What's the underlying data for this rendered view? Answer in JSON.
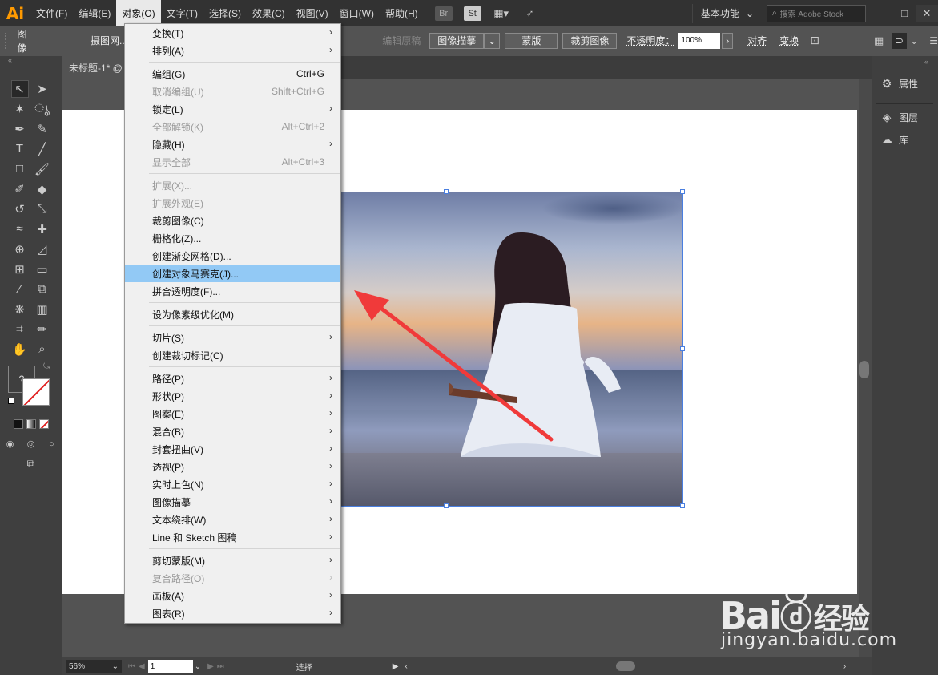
{
  "menubar": {
    "logo": "Ai",
    "items": [
      "文件(F)",
      "编辑(E)",
      "对象(O)",
      "文字(T)",
      "选择(S)",
      "效果(C)",
      "视图(V)",
      "窗口(W)",
      "帮助(H)"
    ],
    "bridge_icon": "Br",
    "stock_icon": "St",
    "workspace": "基本功能",
    "search_placeholder": "搜索 Adobe Stock"
  },
  "control_bar": {
    "label": "图像",
    "embed_button": "摄图网...",
    "edit_original": "编辑原稿",
    "image_trace": "图像描摹",
    "mask": "蒙版",
    "crop": "裁剪图像",
    "opacity_label": "不透明度：",
    "opacity_value": "100%",
    "align": "对齐",
    "transform": "变换"
  },
  "document": {
    "tab_title": "未标题-1* @"
  },
  "right_panel": {
    "items": [
      "属性",
      "图层",
      "库"
    ]
  },
  "object_menu": {
    "items": [
      {
        "label": "变换(T)",
        "shortcut": "",
        "submenu": true,
        "disabled": false
      },
      {
        "label": "排列(A)",
        "shortcut": "",
        "submenu": true,
        "disabled": false
      },
      {
        "sep": true
      },
      {
        "label": "编组(G)",
        "shortcut": "Ctrl+G",
        "submenu": false,
        "disabled": false
      },
      {
        "label": "取消编组(U)",
        "shortcut": "Shift+Ctrl+G",
        "submenu": false,
        "disabled": true
      },
      {
        "label": "锁定(L)",
        "shortcut": "",
        "submenu": true,
        "disabled": false
      },
      {
        "label": "全部解锁(K)",
        "shortcut": "Alt+Ctrl+2",
        "submenu": false,
        "disabled": true
      },
      {
        "label": "隐藏(H)",
        "shortcut": "",
        "submenu": true,
        "disabled": false
      },
      {
        "label": "显示全部",
        "shortcut": "Alt+Ctrl+3",
        "submenu": false,
        "disabled": true
      },
      {
        "sep": true
      },
      {
        "label": "扩展(X)...",
        "shortcut": "",
        "submenu": false,
        "disabled": true
      },
      {
        "label": "扩展外观(E)",
        "shortcut": "",
        "submenu": false,
        "disabled": true
      },
      {
        "label": "裁剪图像(C)",
        "shortcut": "",
        "submenu": false,
        "disabled": false
      },
      {
        "label": "栅格化(Z)...",
        "shortcut": "",
        "submenu": false,
        "disabled": false
      },
      {
        "label": "创建渐变网格(D)...",
        "shortcut": "",
        "submenu": false,
        "disabled": false
      },
      {
        "label": "创建对象马赛克(J)...",
        "shortcut": "",
        "submenu": false,
        "disabled": false,
        "highlighted": true
      },
      {
        "label": "拼合透明度(F)...",
        "shortcut": "",
        "submenu": false,
        "disabled": false
      },
      {
        "sep": true
      },
      {
        "label": "设为像素级优化(M)",
        "shortcut": "",
        "submenu": false,
        "disabled": false
      },
      {
        "sep": true
      },
      {
        "label": "切片(S)",
        "shortcut": "",
        "submenu": true,
        "disabled": false
      },
      {
        "label": "创建裁切标记(C)",
        "shortcut": "",
        "submenu": false,
        "disabled": false
      },
      {
        "sep": true
      },
      {
        "label": "路径(P)",
        "shortcut": "",
        "submenu": true,
        "disabled": false
      },
      {
        "label": "形状(P)",
        "shortcut": "",
        "submenu": true,
        "disabled": false
      },
      {
        "label": "图案(E)",
        "shortcut": "",
        "submenu": true,
        "disabled": false
      },
      {
        "label": "混合(B)",
        "shortcut": "",
        "submenu": true,
        "disabled": false
      },
      {
        "label": "封套扭曲(V)",
        "shortcut": "",
        "submenu": true,
        "disabled": false
      },
      {
        "label": "透视(P)",
        "shortcut": "",
        "submenu": true,
        "disabled": false
      },
      {
        "label": "实时上色(N)",
        "shortcut": "",
        "submenu": true,
        "disabled": false
      },
      {
        "label": "图像描摹",
        "shortcut": "",
        "submenu": true,
        "disabled": false
      },
      {
        "label": "文本绕排(W)",
        "shortcut": "",
        "submenu": true,
        "disabled": false
      },
      {
        "label": "Line 和 Sketch 图稿",
        "shortcut": "",
        "submenu": true,
        "disabled": false
      },
      {
        "sep": true
      },
      {
        "label": "剪切蒙版(M)",
        "shortcut": "",
        "submenu": true,
        "disabled": false
      },
      {
        "label": "复合路径(O)",
        "shortcut": "",
        "submenu": true,
        "disabled": true
      },
      {
        "label": "画板(A)",
        "shortcut": "",
        "submenu": true,
        "disabled": false
      },
      {
        "label": "图表(R)",
        "shortcut": "",
        "submenu": true,
        "disabled": false
      }
    ]
  },
  "status_bar": {
    "zoom": "56%",
    "page": "1",
    "mode": "选择"
  },
  "watermark": {
    "logo": "Bai",
    "logo_cn": "经验",
    "url": "jingyan.baidu.com"
  },
  "colors": {
    "menu_highlight": "#92c9f5",
    "arrow": "#f03a3a",
    "selection": "#4a7fe0"
  }
}
